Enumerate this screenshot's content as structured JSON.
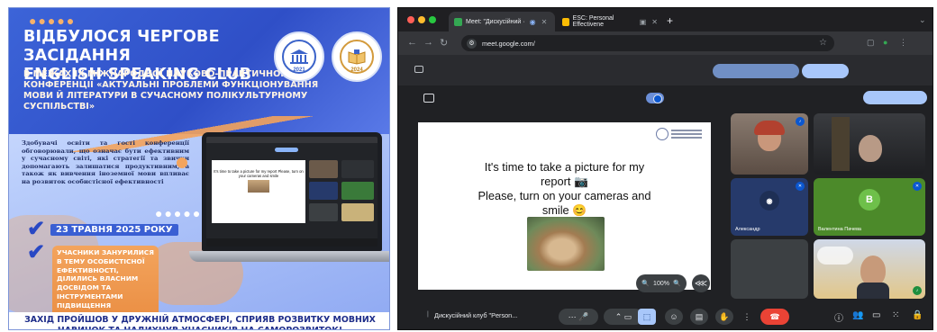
{
  "poster": {
    "title_line1": "ВІДБУЛОСЯ ЧЕРГОВЕ ЗАСІДАННЯ",
    "title_line2": "ENGLISH SPEAKING CLUB",
    "subtitle": "В МЕЖАХ ІХ МІЖНАРОДНОЇ НАУКОВО-ПРАКТИЧНОЇ КОНФЕРЕНЦІЇ «АКТУАЛЬНІ ПРОБЛЕМИ ФУНКЦІОНУВАННЯ МОВИ Й ЛІТЕРАТУРИ В СУЧАСНОМУ ПОЛІКУЛЬТУРНОМУ СУСПІЛЬСТВІ»",
    "seal_left_year": "2021",
    "seal_right_year": "2024",
    "paragraph": "Здобувачі освіти та гості конференції обговорювали, що означає бути ефективним у сучасному світі, які стратегії та звички допомагають залишатися продуктивним, а також як вивчення іноземної мови впливає на розвиток особистісної ефективності",
    "date": "23 ТРАВНЯ 2025 РОКУ",
    "result": "УЧАСНИКИ ЗАНУРИЛИСЯ В ТЕМУ ОСОБИСТІСНОЇ ЕФЕКТИВНОСТІ, ДІЛИЛИСЬ ВЛАСНИМ ДОСВІДОМ ТА ІНСТРУМЕНТАМИ ПІДВИЩЕННЯ ПРОДУКТИВНОСТІ",
    "footer": "ЗАХІД ПРОЙШОВ У ДРУЖНІЙ АТМОСФЕРІ, СПРИЯВ РОЗВИТКУ МОВНИХ НАВИЧОК ТА НАДИХНУВ УЧАСНИКІВ НА САМОРОЗВИТОК!",
    "dots": "●●●●●",
    "mini_slide_text": "It's time to take a picture for my report Please, turn on your cameras and smile"
  },
  "browser": {
    "tabs": [
      {
        "label": "Meet: \"Дискусійний ·",
        "active": true,
        "favicon_color": "#34a853"
      },
      {
        "label": "ESC: Personal Effectivene",
        "active": false,
        "favicon_color": "#fbbc04"
      }
    ],
    "new_tab": "+",
    "url": "meet.google.com/",
    "slide_line1": "It's time to take a picture for my",
    "slide_line2": "report 📷",
    "slide_line3": "Please, turn on your cameras and",
    "slide_line4": "smile 😊",
    "zoom_level": "100%",
    "participants": [
      {
        "name": "",
        "kind": "video"
      },
      {
        "name": "",
        "kind": "video"
      },
      {
        "name": "Александр",
        "kind": "avatar"
      },
      {
        "name": "Валентина Пачева",
        "kind": "avatar",
        "initial": "В"
      },
      {
        "name": "",
        "kind": "empty"
      },
      {
        "name": "",
        "kind": "video"
      }
    ],
    "meeting_name": "Дискусійний клуб \"Person...",
    "accent": "#a8c7fa",
    "hangup_color": "#ea4335"
  }
}
